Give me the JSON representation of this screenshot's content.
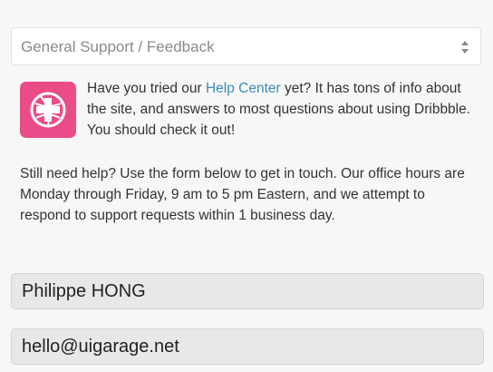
{
  "topic_select": {
    "selected": "General Support / Feedback"
  },
  "help_notice": {
    "text_before": "Have you tried our ",
    "link_label": "Help Center",
    "text_after": " yet? It has tons of info about the site, and answers to most questions about using Dribbble. You should check it out!",
    "icon": "help-center-icon"
  },
  "info": {
    "text": "Still need help? Use the form below to get in touch. Our office hours are Monday through Friday, 9 am to 5 pm Eastern, and we attempt to respond to support requests within 1 business day."
  },
  "form": {
    "name_value": "Philippe HONG",
    "email_value": "hello@uigarage.net"
  },
  "colors": {
    "brand_pink": "#ea4c89",
    "link": "#3a8bbb"
  }
}
